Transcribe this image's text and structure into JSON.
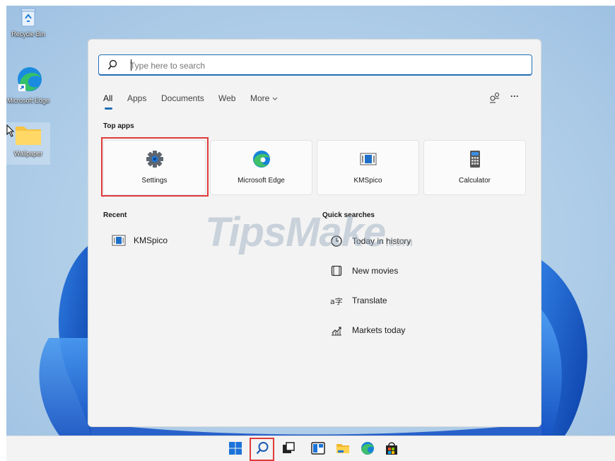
{
  "desktop": {
    "icons": [
      {
        "label": "Recycle Bin",
        "icon": "recycle-bin-icon"
      },
      {
        "label": "Microsoft Edge",
        "icon": "edge-shortcut-icon"
      },
      {
        "label": "Wallpaper",
        "icon": "folder-icon"
      }
    ]
  },
  "search": {
    "placeholder": "Type here to search",
    "value": ""
  },
  "tabs": [
    {
      "label": "All",
      "active": true
    },
    {
      "label": "Apps"
    },
    {
      "label": "Documents"
    },
    {
      "label": "Web"
    },
    {
      "label": "More"
    }
  ],
  "toolbar": {
    "more_options": "···",
    "account_icon": "people-icon"
  },
  "top_apps": {
    "heading": "Top apps",
    "items": [
      {
        "label": "Settings",
        "icon": "gear-icon",
        "highlighted": true
      },
      {
        "label": "Microsoft Edge",
        "icon": "edge-icon"
      },
      {
        "label": "KMSpico",
        "icon": "kmspico-icon"
      },
      {
        "label": "Calculator",
        "icon": "calculator-icon"
      }
    ]
  },
  "recent": {
    "heading": "Recent",
    "items": [
      {
        "label": "KMSpico",
        "icon": "kmspico-icon"
      }
    ]
  },
  "quick_searches": {
    "heading": "Quick searches",
    "items": [
      {
        "label": "Today in history",
        "icon": "clock-icon"
      },
      {
        "label": "New movies",
        "icon": "film-icon"
      },
      {
        "label": "Translate",
        "icon": "translate-icon"
      },
      {
        "label": "Markets today",
        "icon": "chart-up-icon"
      }
    ]
  },
  "watermark": {
    "main": "TipsMake",
    "suffix": ".com"
  },
  "taskbar": {
    "items": [
      "start-icon",
      "search-icon",
      "task-view-icon",
      "widgets-icon",
      "file-explorer-icon",
      "edge-icon",
      "store-icon"
    ],
    "highlighted": "search-icon"
  },
  "colors": {
    "accent": "#1f6fb5",
    "highlight": "#e03a3a"
  }
}
